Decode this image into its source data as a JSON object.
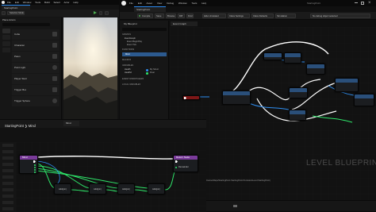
{
  "left_window": {
    "menu": [
      "File",
      "Edit",
      "Window",
      "Tools",
      "Build",
      "Select",
      "Actor",
      "Help"
    ],
    "tab_title": "StartingPoint",
    "mode_label": "Selection Mode",
    "place_actors_title": "Place Actors",
    "actor_items": [
      "Cube",
      "Character",
      "Pawn",
      "Point Light",
      "Player Start",
      "Trigger Box",
      "Trigger Sphere"
    ],
    "bottom_menu": "Mesh",
    "bottom_labels": [
      "Out"
    ]
  },
  "right_window": {
    "menu": [
      "File",
      "Edit",
      "Asset",
      "View",
      "Debug",
      "Window",
      "Tools",
      "Help"
    ],
    "tab_title": "StartingPoint",
    "title_right": "StartingPoint",
    "toolbar": [
      "Compile",
      "Save",
      "Browse",
      "Diff",
      "Find",
      "Hide Unrelated",
      "Class Settings",
      "Class Defaults",
      "Simulation"
    ],
    "debug_filter": "No debug object selected",
    "event_graph_tab": "Event Graph",
    "breadcrumb": "StartingPoint ❯ Event Graph",
    "my_blueprint_title": "My Blueprint",
    "sections": {
      "graphs": "GRAPHS",
      "event_graph": "EventGraph",
      "event_begin_play": "Event BeginPlay",
      "event_tick": "Event Tick",
      "functions": "FUNCTIONS",
      "mind": "Mind",
      "macros": "MACROS",
      "variables": "VARIABLES",
      "var_health": "Health",
      "var_type": "My Struct",
      "var_health2": "Health2",
      "var_type2": "Float",
      "event_dispatchers": "EVENT DISPATCHERS",
      "local_variables": "LOCAL VARIABLES"
    },
    "graph_labels": {
      "mind_node": "Mind"
    },
    "watermark": "LEVEL BLUEPRINT",
    "compile_status": "StartingPoint, successful [in 48 ms] (/Game/Maps/StartingPoint.StartingPoint:PersistentLevel.StartingPoint)"
  },
  "mind_graph": {
    "breadcrumb": "StartingPoint ❯ Mind",
    "tab": "Mind",
    "entry_node": "Mind",
    "return_node": "Return Node",
    "return_pin": "Remainder",
    "add_nodes": [
      "Add(pin)",
      "Add(pin)",
      "Add(pin)",
      "Add(pin)"
    ],
    "footer_info": "●●●"
  },
  "colors": {
    "accent": "#2c8af0",
    "function_head": "#7a3b9a",
    "event_head": "#7e1717",
    "exec_white": "#ffffff",
    "float_green": "#2ee66a",
    "object_blue": "#2f8ef0"
  }
}
